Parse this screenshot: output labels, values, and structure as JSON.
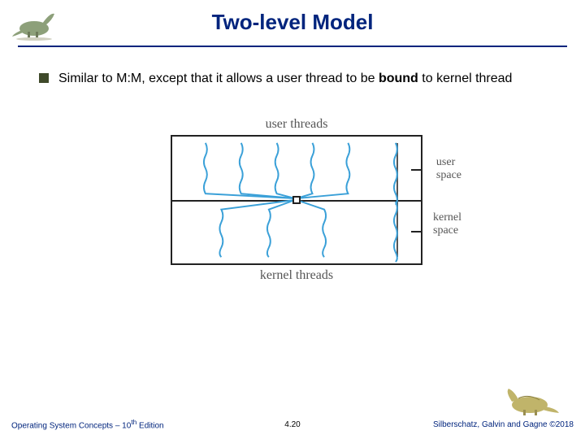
{
  "slide": {
    "title": "Two-level Model",
    "bullet_pre": "Similar to M:M, except that it allows a user thread to be ",
    "bullet_bold": "bound",
    "bullet_post": " to kernel thread"
  },
  "diagram": {
    "top_label": "user threads",
    "bottom_label": "kernel threads",
    "side_user_l1": "user",
    "side_user_l2": "space",
    "side_kernel_l1": "kernel",
    "side_kernel_l2": "space"
  },
  "footer": {
    "left_pre": "Operating System Concepts – 10",
    "left_sup": "th",
    "left_post": " Edition",
    "page": "4.20",
    "right_pre": "Silberschatz, Galvin and Gagne ",
    "right_copy": "©",
    "right_year": "2018"
  }
}
